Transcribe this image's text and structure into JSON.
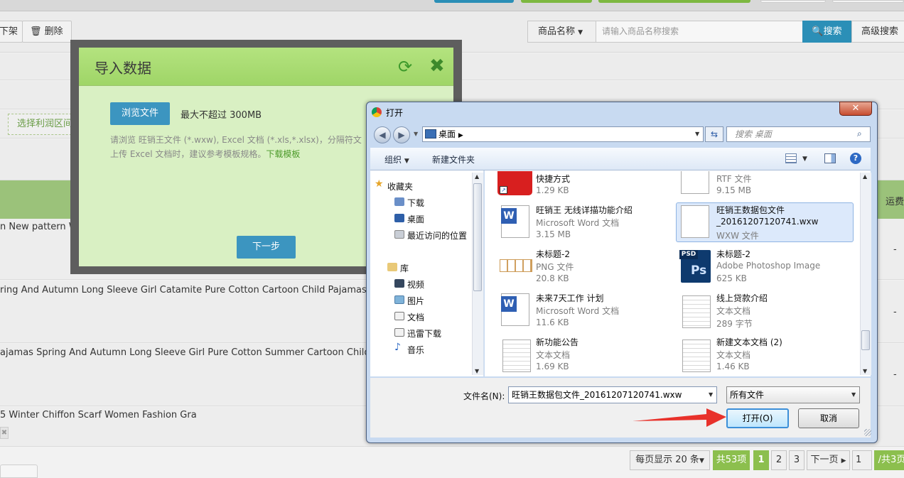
{
  "background_page": {
    "toolbar": {
      "offshelf_partial": "下架",
      "delete_label": "删除"
    },
    "search": {
      "field_select": "商品名称",
      "placeholder": "请输入商品名称搜索",
      "search_btn": "搜索",
      "advanced_btn": "高级搜索"
    },
    "profit_select": "选择利润区间",
    "header_right": "运费",
    "rows": [
      "n New pattern Wi",
      "ring And Autumn Long Sleeve Girl Catamite Pure Cotton Cartoon Child Pajamas Sui",
      "ajamas Spring And Autumn Long Sleeve Girl Pure Cotton Summer Cartoon Child Paja",
      "5 Winter Chiffon Scarf Women Fashion Gra"
    ],
    "row_dash": "-",
    "pager": {
      "per_page": "每页显示 20 条",
      "total": "共53项",
      "pages": [
        "1",
        "2",
        "3"
      ],
      "next": "下一页",
      "page_input": "1",
      "total_pages": "/共3页"
    }
  },
  "import_dialog": {
    "title": "导入数据",
    "browse_btn": "浏览文件",
    "max_size": "最大不超过 300MB",
    "desc_line1": "请浏览 旺销王文件 (*.wxw), Excel 文档 (*.xls,*.xlsx)，分隔符文",
    "desc_line2": "上传 Excel 文档时，建议参考模板规格。",
    "template_link": "下载模板",
    "next_btn": "下一步"
  },
  "open_dialog": {
    "title": "打开",
    "address": "桌面",
    "search_placeholder": "搜索 桌面",
    "organize": "组织",
    "new_folder": "新建文件夹",
    "nav": {
      "favorites": "收藏夹",
      "items_fav": [
        "下载",
        "桌面",
        "最近访问的位置"
      ],
      "library": "库",
      "items_lib": [
        "视频",
        "图片",
        "文档",
        "迅雷下载",
        "音乐"
      ]
    },
    "files": [
      {
        "name": "快捷方式",
        "name2": "",
        "type": "",
        "size": "1.29 KB",
        "icon": "shortcut-app-icon"
      },
      {
        "name": "RTF 文件",
        "name2": "",
        "type": "",
        "size": "9.15 MB",
        "icon": "word-doc-icon"
      },
      {
        "name": "旺销王 无线详描功能介绍",
        "name2": "",
        "type": "Microsoft Word 文档",
        "size": "3.15 MB",
        "icon": "word-doc-icon"
      },
      {
        "name": "旺销王数据包文件",
        "name2": "_20161207120741.wxw",
        "type": "WXW 文件",
        "size": "",
        "icon": "blank-file-icon"
      },
      {
        "name": "未标题-2",
        "name2": "",
        "type": "PNG 文件",
        "size": "20.8 KB",
        "icon": "png-image-icon"
      },
      {
        "name": "未标题-2",
        "name2": "",
        "type": "Adobe Photoshop Image",
        "size": "625 KB",
        "icon": "psd-file-icon"
      },
      {
        "name": "未来7天工作 计划",
        "name2": "",
        "type": "Microsoft Word 文档",
        "size": "11.6 KB",
        "icon": "word-doc-icon"
      },
      {
        "name": "线上贷款介绍",
        "name2": "",
        "type": "文本文档",
        "size": "289 字节",
        "icon": "text-file-icon"
      },
      {
        "name": "新功能公告",
        "name2": "",
        "type": "文本文档",
        "size": "1.69 KB",
        "icon": "text-file-icon"
      },
      {
        "name": "新建文本文档 (2)",
        "name2": "",
        "type": "文本文档",
        "size": "1.46 KB",
        "icon": "text-file-icon"
      }
    ],
    "filename_label": "文件名(N):",
    "filename_value": "旺销王数据包文件_20161207120741.wxw",
    "filetype": "所有文件",
    "open_btn": "打开(O)",
    "cancel_btn": "取消"
  },
  "colors": {
    "accent_blue": "#3c95c0",
    "green_header": "#9fd567",
    "annotation_arrow": "#e8312a"
  }
}
